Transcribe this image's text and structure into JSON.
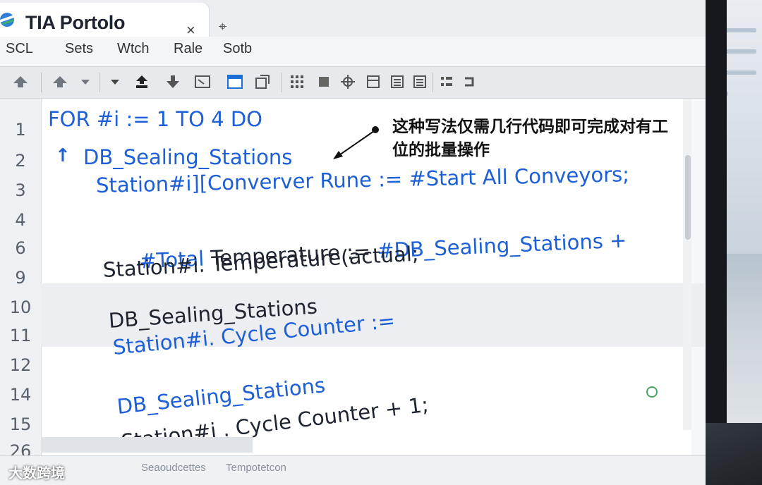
{
  "window": {
    "title": "TIA Portolo",
    "close_glyph": "×",
    "newtab_glyph": "⌖"
  },
  "menu": [
    "SCL",
    "Sets",
    "Wtch",
    "Rale",
    "Sotb"
  ],
  "toolbar_icons": [
    "up-arrow-icon",
    "up-arrow-dropdown-icon",
    "dropdown-arrow-icon",
    "upload-icon",
    "download-icon",
    "compare-icon",
    "window-icon",
    "copy-icon",
    "grid-icon",
    "print-icon",
    "network-icon",
    "block-icon",
    "list-icon",
    "list2-icon",
    "table-icon",
    "refresh-icon"
  ],
  "editor": {
    "line_numbers": [
      "1",
      "2",
      "3",
      "4",
      "6",
      "9",
      "10",
      "11",
      "12",
      "14",
      "15",
      "26"
    ],
    "code": {
      "l1": "FOR #i := 1 TO 4 DO",
      "l2_arrow": "↑",
      "l2": "DB_Sealing_Stations",
      "l3": "Station#i][Converver Rune := #Start All Conveyors;",
      "l4": "#Total Temperature := #DB_Sealing_Stations +",
      "l5": "Station#i. Temperature(actual;",
      "l6": "DB_Sealing_Stations",
      "l7": "Station#i. Cycle Counter :=",
      "l8": "DB_Sealing_Stations",
      "l9": "Station#i . Cycle Counter + 1;"
    },
    "annotation": "这种写法仅需几行代码即可完成对有工位的批量操作"
  },
  "status": {
    "tab1": "Seaoudcettes",
    "tab2": "Tempotetcon"
  },
  "watermark": "大数跨境",
  "colors": {
    "keyword_blue": "#1d5fd6",
    "text_dark": "#1e2430"
  }
}
